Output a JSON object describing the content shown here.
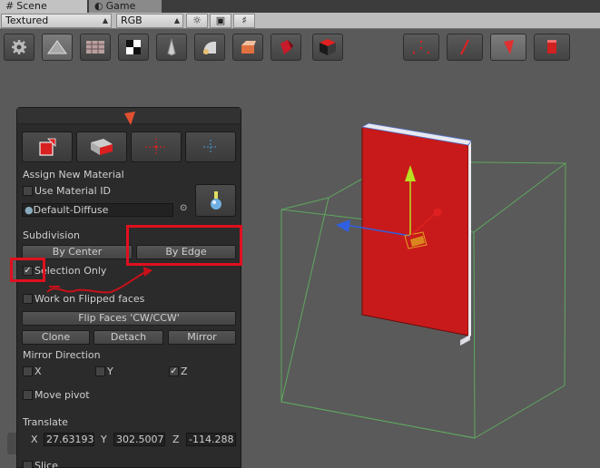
{
  "tabs": [
    {
      "label": "Scene",
      "icon": "grid-icon",
      "active": true
    },
    {
      "label": "Game",
      "icon": "game-icon",
      "active": false
    }
  ],
  "scene_toolbar": {
    "draw_mode": "Textured",
    "render_mode": "RGB",
    "lighting_icon": "sun-icon",
    "image_icon": "image-icon",
    "audio_icon": "speaker-icon"
  },
  "tools": [
    "settings-gear-icon",
    "object-mode-icon",
    "texture-grid-icon",
    "checker-icon",
    "vertex-color-icon",
    "smoothing-icon",
    "bevel-icon",
    "shape-icon",
    "cube-red-icon"
  ],
  "select_modes": [
    "vertex-mode-icon",
    "edge-mode-icon",
    "face-mode-icon",
    "element-mode-icon"
  ],
  "panel": {
    "assign_label": "Assign New Material",
    "use_material_id": "Use Material ID",
    "material_name": "Default-Diffuse",
    "subdivision_label": "Subdivision",
    "by_center": "By Center",
    "by_edge": "By Edge",
    "selection_only": "Selection Only",
    "work_on_flipped": "Work on Flipped faces",
    "flip_faces": "Flip Faces 'CW/CCW'",
    "clone": "Clone",
    "detach": "Detach",
    "mirror": "Mirror",
    "mirror_direction": "Mirror Direction",
    "mirror_x": "X",
    "mirror_y": "Y",
    "mirror_z": "Z",
    "move_pivot": "Move pivot",
    "translate_label": "Translate",
    "tx_label": "X",
    "tx_value": "27.63193",
    "ty_label": "Y",
    "ty_value": "302.5007",
    "tz_label": "Z",
    "tz_value": "-114.288",
    "slice": "Slice"
  },
  "colors": {
    "accent_red": "#e0101e",
    "face_red": "#c81a1a",
    "bounds_green": "#6db56d"
  }
}
